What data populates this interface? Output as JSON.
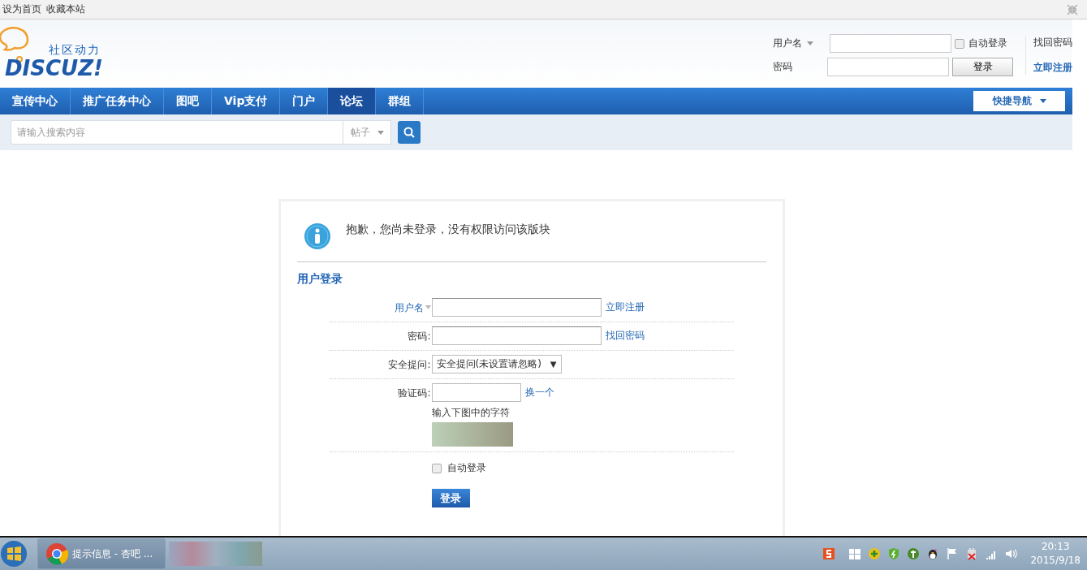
{
  "top_links": [
    "设为首页",
    "收藏本站"
  ],
  "logo": {
    "tagline": "社区动力",
    "wordmark": "DISCUZ!"
  },
  "header_login": {
    "username_label": "用户名",
    "password_label": "密码",
    "auto_login": {
      "label": "自动登录",
      "checked": false
    },
    "login_button": "登录",
    "forgot_link": "找回密码",
    "register_link": "立即注册"
  },
  "nav": {
    "items": [
      {
        "label": "宣传中心",
        "selected": false
      },
      {
        "label": "推广任务中心",
        "selected": false
      },
      {
        "label": "图吧",
        "selected": false
      },
      {
        "label": "Vip支付",
        "selected": false
      },
      {
        "label": "门户",
        "selected": false
      },
      {
        "label": "论坛",
        "selected": true
      },
      {
        "label": "群组",
        "selected": false
      }
    ],
    "quick_nav": "快捷导航"
  },
  "search": {
    "placeholder": "请输入搜索内容",
    "scope": "帖子"
  },
  "message": "抱歉，您尚未登录，没有权限访问该版块",
  "login_form": {
    "title": "用户登录",
    "rows": [
      {
        "kind": "input",
        "label": "用户名",
        "has_caret": true,
        "link": "立即注册"
      },
      {
        "kind": "input",
        "label": "密码:",
        "link": "找回密码"
      },
      {
        "kind": "select",
        "label": "安全提问:",
        "value": "安全提问(未设置请忽略)",
        "arrow": "▼"
      },
      {
        "kind": "captcha",
        "label": "验证码:",
        "link": "换一个",
        "hint": "输入下图中的字符"
      }
    ],
    "auto_login": {
      "label": "自动登录",
      "checked": false
    },
    "submit": "登录"
  },
  "taskbar": {
    "window_title": "提示信息 - 杏吧 ...",
    "time": "20:13",
    "date": "2015/9/18"
  }
}
